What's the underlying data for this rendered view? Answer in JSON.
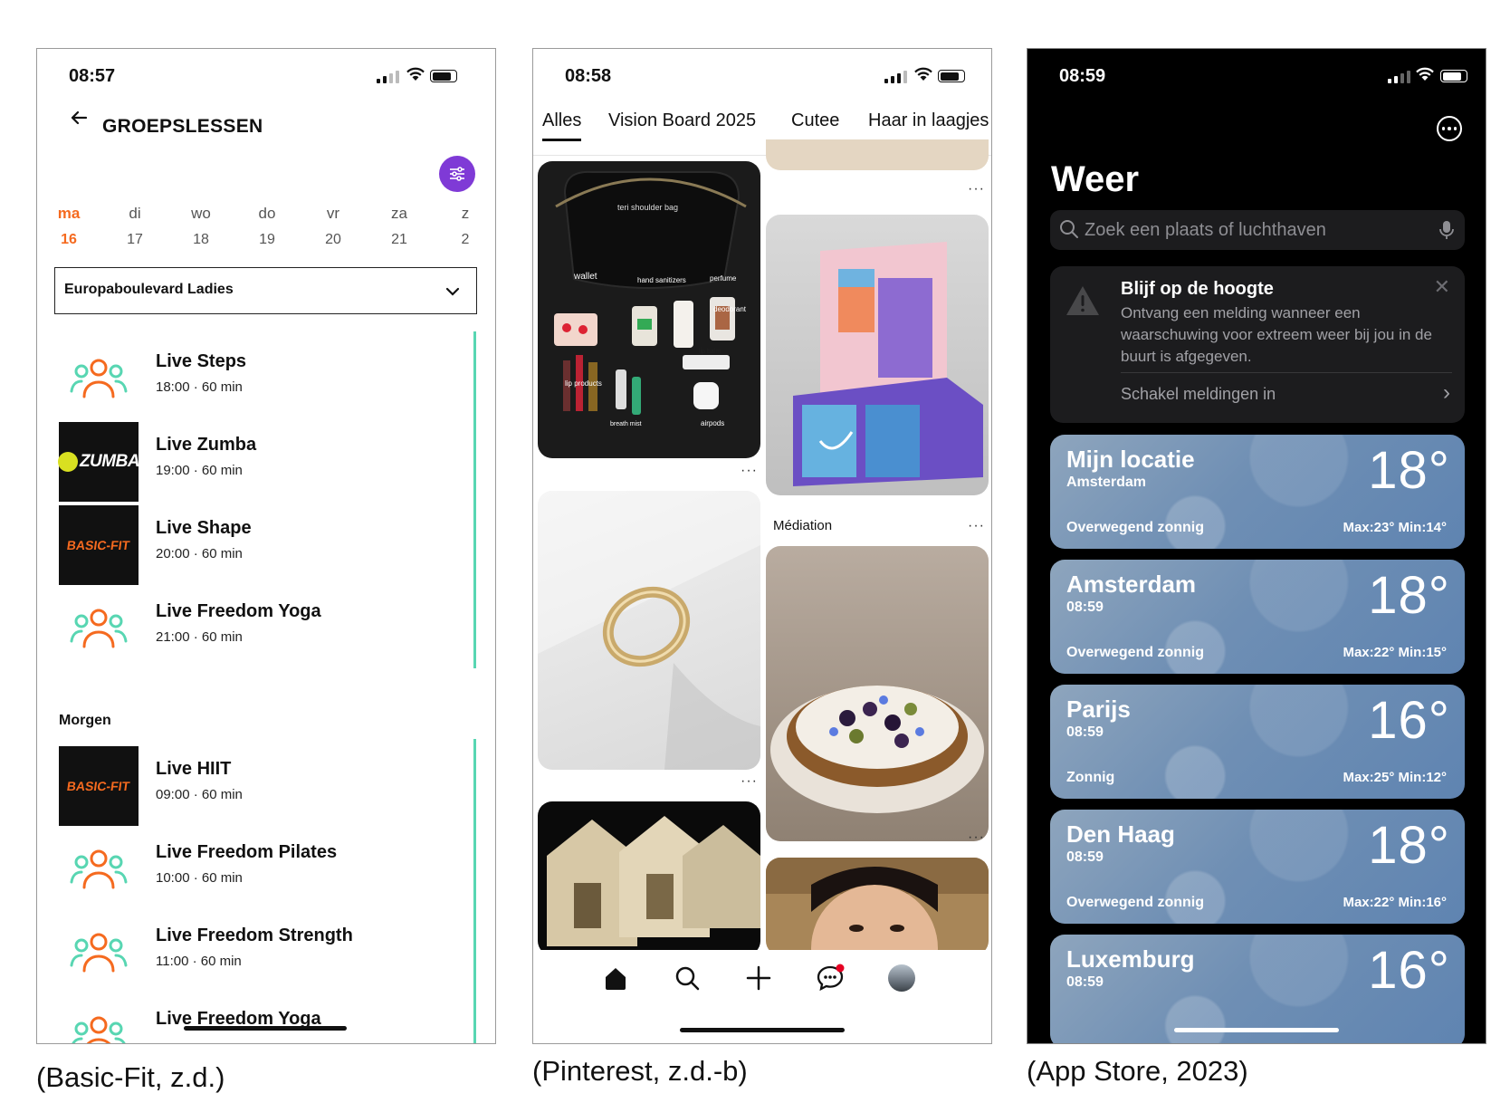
{
  "basicfit": {
    "status_time": "08:57",
    "title": "GROEPSLESSEN",
    "days": [
      {
        "label": "ma",
        "num": "16",
        "active": true
      },
      {
        "label": "di",
        "num": "17"
      },
      {
        "label": "wo",
        "num": "18"
      },
      {
        "label": "do",
        "num": "19"
      },
      {
        "label": "vr",
        "num": "20"
      },
      {
        "label": "za",
        "num": "21"
      },
      {
        "label": "z",
        "num": "2"
      }
    ],
    "club_select": "Europaboulevard Ladies",
    "classes_today": [
      {
        "name": "Live Steps",
        "meta": "18:00 · 60 min",
        "thumb": "people-icon"
      },
      {
        "name": "Live Zumba",
        "meta": "19:00 · 60 min",
        "thumb": "zumba-logo",
        "logo_text": "ZUMBA"
      },
      {
        "name": "Live Shape",
        "meta": "20:00 · 60 min",
        "thumb": "basicfit-logo",
        "logo_text": "BASIC-FIT"
      },
      {
        "name": "Live Freedom Yoga",
        "meta": "21:00 · 60 min",
        "thumb": "people-icon"
      }
    ],
    "section_tomorrow": "Morgen",
    "classes_tomorrow": [
      {
        "name": "Live HIIT",
        "meta": "09:00 · 60 min",
        "thumb": "basicfit-logo",
        "logo_text": "BASIC-FIT"
      },
      {
        "name": "Live Freedom Pilates",
        "meta": "10:00 · 60 min",
        "thumb": "people-icon"
      },
      {
        "name": "Live Freedom Strength",
        "meta": "11:00 · 60 min",
        "thumb": "people-icon"
      },
      {
        "name": "Live Freedom Yoga",
        "meta": "",
        "thumb": "people-icon"
      }
    ],
    "colors": {
      "accent": "#f56a1f",
      "filter_button": "#7f3ad6",
      "divider": "#58d6b2"
    }
  },
  "pinterest": {
    "status_time": "08:58",
    "tabs": [
      "Alles",
      "Vision Board 2025",
      "Cutee",
      "Haar in laagjes"
    ],
    "pin_texts": {
      "bag_title": "teri shoulder bag",
      "wallet": "wallet",
      "hand_sanitizers": "hand sanitizers",
      "perfume": "perfume",
      "deodorant": "deodorant",
      "lip_balm": "lip balm",
      "lip_products": "lip products",
      "breath_mist": "breath mist",
      "airpods": "airpods"
    },
    "pin_label_mediation": "Médiation",
    "more_dots": "···",
    "nav": [
      "home-icon",
      "search-icon",
      "plus-icon",
      "messages-icon",
      "profile-avatar"
    ]
  },
  "weather": {
    "status_time": "08:59",
    "title": "Weer",
    "search_placeholder": "Zoek een plaats of luchthaven",
    "alert": {
      "title": "Blijf op de hoogte",
      "body": "Ontvang een melding wanneer een waarschuwing voor extreem weer bij jou in de buurt is afgegeven.",
      "link": "Schakel meldingen in",
      "close": "✕",
      "arrow": "›"
    },
    "cards": [
      {
        "city": "Mijn locatie",
        "sub": "Amsterdam",
        "temp": "18°",
        "cond": "Overwegend zonnig",
        "range": "Max:23°  Min:14°"
      },
      {
        "city": "Amsterdam",
        "sub": "08:59",
        "temp": "18°",
        "cond": "Overwegend zonnig",
        "range": "Max:22°  Min:15°"
      },
      {
        "city": "Parijs",
        "sub": "08:59",
        "temp": "16°",
        "cond": "Zonnig",
        "range": "Max:25°  Min:12°"
      },
      {
        "city": "Den Haag",
        "sub": "08:59",
        "temp": "18°",
        "cond": "Overwegend zonnig",
        "range": "Max:22°  Min:16°"
      },
      {
        "city": "Luxemburg",
        "sub": "08:59",
        "temp": "16°",
        "cond": "",
        "range": ""
      }
    ]
  },
  "captions": {
    "left": "(Basic-Fit, z.d.)",
    "middle": "(Pinterest, z.d.-b)",
    "right": "(App Store, 2023)"
  }
}
